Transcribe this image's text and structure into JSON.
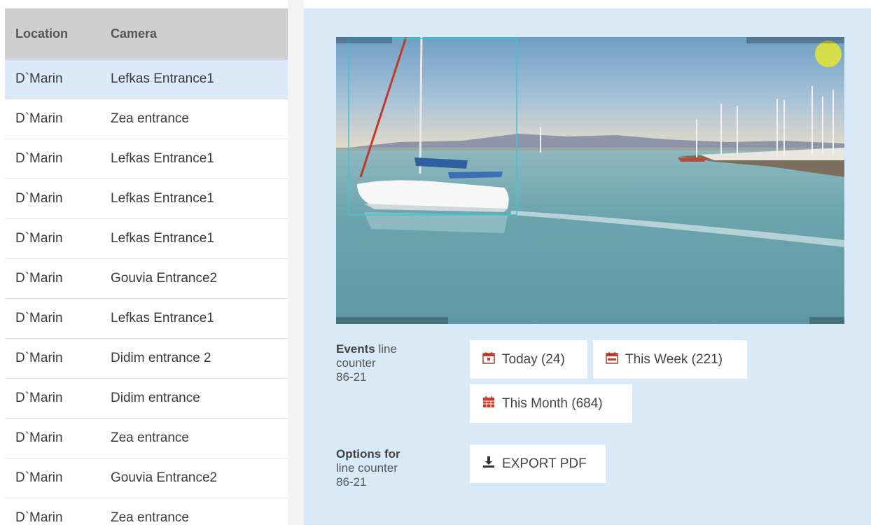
{
  "table": {
    "headers": {
      "location": "Location",
      "camera": "Camera"
    },
    "rows": [
      {
        "location": "D`Marin",
        "camera": "Lefkas Entrance1",
        "selected": true
      },
      {
        "location": "D`Marin",
        "camera": "Zea entrance"
      },
      {
        "location": "D`Marin",
        "camera": "Lefkas Entrance1"
      },
      {
        "location": "D`Marin",
        "camera": "Lefkas Entrance1"
      },
      {
        "location": "D`Marin",
        "camera": "Lefkas Entrance1"
      },
      {
        "location": "D`Marin",
        "camera": "Gouvia Entrance2"
      },
      {
        "location": "D`Marin",
        "camera": "Lefkas Entrance1"
      },
      {
        "location": "D`Marin",
        "camera": "Didim entrance 2"
      },
      {
        "location": "D`Marin",
        "camera": "Didim entrance"
      },
      {
        "location": "D`Marin",
        "camera": "Zea entrance"
      },
      {
        "location": "D`Marin",
        "camera": "Gouvia Entrance2"
      },
      {
        "location": "D`Marin",
        "camera": "Zea entrance"
      }
    ]
  },
  "events": {
    "title_bold": "Events",
    "title_rest": " line counter",
    "id": "86-21",
    "buttons": {
      "today": "Today (24)",
      "week": "This Week (221)",
      "month": "This Month (684)"
    }
  },
  "options": {
    "title_bold": "Options for",
    "line1": "line counter",
    "id": "86-21",
    "export": "EXPORT PDF"
  },
  "icons": {
    "today": "calendar-day-icon",
    "week": "calendar-week-icon",
    "month": "calendar-month-icon",
    "export": "download-icon"
  },
  "colors": {
    "selected_row": "#dbe9f8",
    "panel_bg": "#d8e9f8",
    "header_bg": "#cfcfcf",
    "calendar_red": "#c0392b",
    "detection_box": "#39c6d8"
  }
}
